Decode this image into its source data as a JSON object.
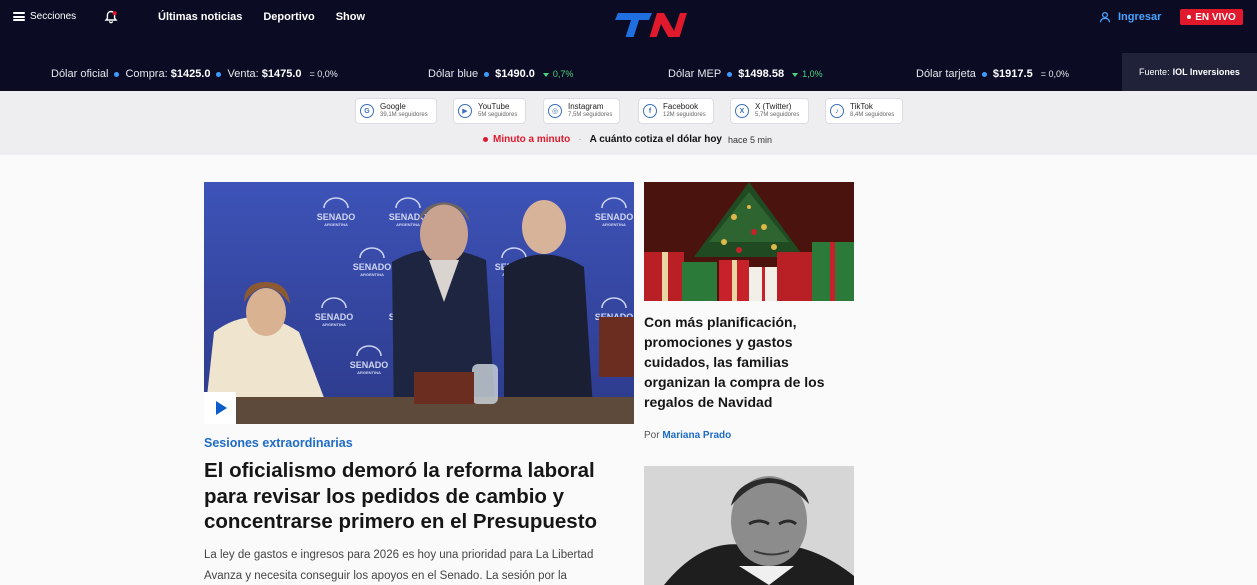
{
  "nav": {
    "menu_label": "Secciones",
    "links": [
      "Últimas noticias",
      "Deportivo",
      "Show"
    ],
    "login_label": "Ingresar",
    "live_label": "EN VIVO",
    "logo_icon": "tn-logo"
  },
  "ticker": {
    "items": [
      {
        "name": "Dólar oficial",
        "compra_label": "Compra:",
        "compra": "$1425.0",
        "venta_label": "Venta:",
        "venta": "$1475.0",
        "variation": "= 0,0%"
      },
      {
        "name": "Dólar blue",
        "value": "$1490.0",
        "variation": "0,7%"
      },
      {
        "name": "Dólar MEP",
        "value": "$1498.58",
        "variation": "1,0%"
      },
      {
        "name": "Dólar tarjeta",
        "value": "$1917.5",
        "variation": "= 0,0%"
      }
    ],
    "source_label": "Fuente:",
    "source_name": "IOL Inversiones"
  },
  "social": [
    {
      "name": "Google",
      "followers": "39,1M seguidores",
      "icon": "google-icon"
    },
    {
      "name": "YouTube",
      "followers": "5M seguidores",
      "icon": "youtube-icon"
    },
    {
      "name": "Instagram",
      "followers": "7,5M seguidores",
      "icon": "instagram-icon"
    },
    {
      "name": "Facebook",
      "followers": "12M seguidores",
      "icon": "facebook-icon"
    },
    {
      "name": "X (Twitter)",
      "followers": "5,7M seguidores",
      "icon": "x-icon"
    },
    {
      "name": "TikTok",
      "followers": "8,4M seguidores",
      "icon": "tiktok-icon"
    }
  ],
  "minuto": {
    "label": "Minuto a minuto",
    "headline": "A cuánto cotiza el dólar hoy",
    "time": "hace 5 min"
  },
  "main_story": {
    "kicker": "Sesiones extraordinarias",
    "headline": "El oficialismo demoró la reforma laboral para revisar los pedidos de cambio y concentrarse primero en el Presupuesto",
    "summary": "La ley de gastos e ingresos para 2026 es hoy una prioridad para La Libertad Avanza y necesita conseguir los apoyos en el Senado. La sesión por la",
    "backdrop_text": "SENADO",
    "backdrop_sub": "ARGENTINA"
  },
  "side_story": {
    "headline": "Con más planificación, promociones y gastos cuidados, las familias organizan la compra de los regalos de Navidad",
    "byline_prefix": "Por",
    "author": "Mariana Prado"
  },
  "colors": {
    "nav_bg": "#0b0c24",
    "accent_blue": "#1e6bc6",
    "live_red": "#e1192d",
    "up_green": "#4bd37b"
  }
}
